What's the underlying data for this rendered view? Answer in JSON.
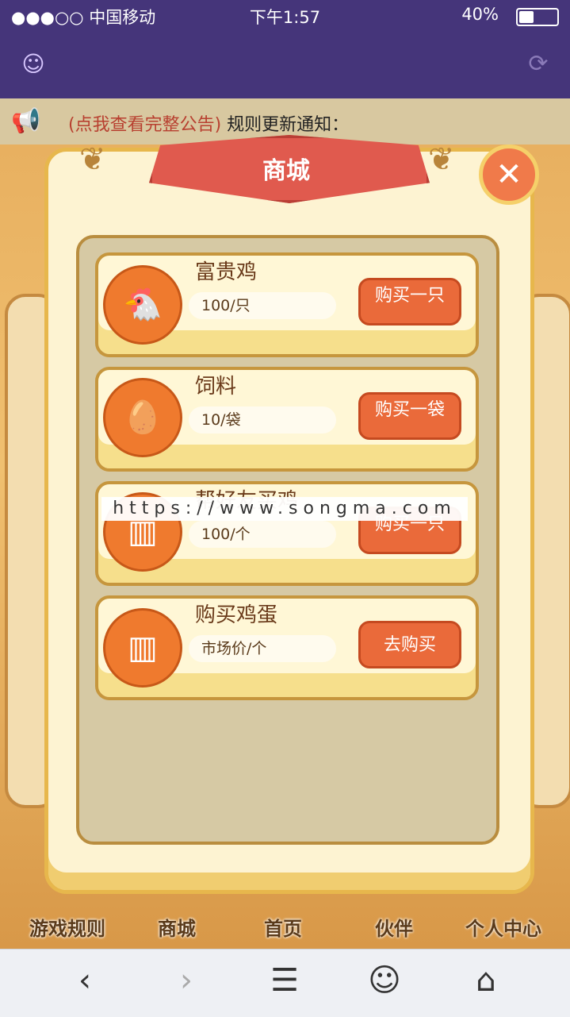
{
  "status_bar": {
    "carrier": "●●●○○ 中国移动",
    "time": "下午1:57",
    "battery": "40%"
  },
  "header": {
    "left_icon": "ghost-icon",
    "right_icon": "refresh-icon"
  },
  "notice": {
    "link": "(点我查看完整公告)",
    "text": "规则更新通知："
  },
  "modal": {
    "title": "商城",
    "items": [
      {
        "name": "富贵鸡",
        "price": "100/只",
        "button": "购买一只",
        "icon": "chicken-icon"
      },
      {
        "name": "饲料",
        "price": "10/袋",
        "button": "购买一袋",
        "icon": "eggs-icon"
      },
      {
        "name": "帮好友买鸡",
        "price": "100/个",
        "button": "购买一只",
        "icon": "barcode-icon"
      },
      {
        "name": "购买鸡蛋",
        "price": "市场价/个",
        "button": "去购买",
        "icon": "barcode-icon"
      }
    ]
  },
  "watermark": "https://www.songma.com",
  "bottom_nav": [
    "游戏规则",
    "商城",
    "首页",
    "伙伴",
    "个人中心"
  ],
  "browser": {
    "icons": [
      "back-icon",
      "forward-icon",
      "menu-icon",
      "ghost-icon",
      "home-icon"
    ]
  }
}
